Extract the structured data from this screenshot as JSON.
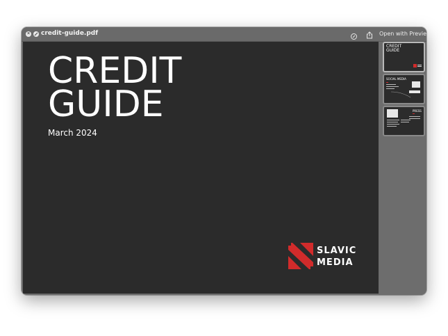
{
  "window": {
    "filename": "credit-guide.pdf",
    "open_with_label": "Open with Preview",
    "close_glyph": "×",
    "icons": [
      "close-icon",
      "x-circle-icon",
      "annotate-icon",
      "share-icon"
    ]
  },
  "page": {
    "title_line1": "CREDIT",
    "title_line2": "GUIDE",
    "date": "March 2024",
    "logo_line1": "SLAVIC",
    "logo_line2": "MEDIA",
    "background": "#2b2b2b",
    "accent": "#d12b2b"
  },
  "thumbnails": [
    {
      "label_line1": "CREDIT",
      "label_line2": "GUIDE",
      "selected": true
    },
    {
      "label_line1": "SOCIAL MEDIA",
      "selected": false
    },
    {
      "label_line1": "PRESS",
      "selected": false
    }
  ]
}
